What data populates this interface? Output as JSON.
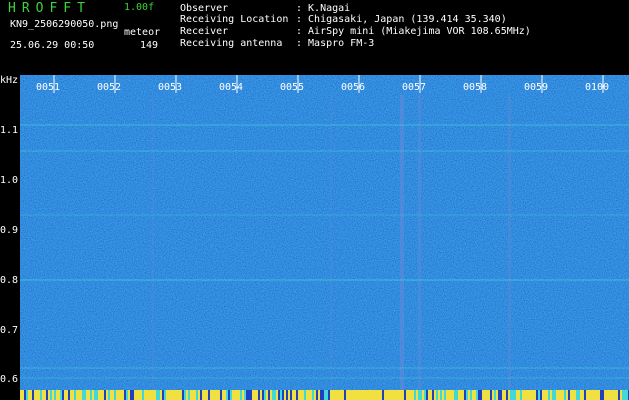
{
  "header": {
    "logo": "HROFFT",
    "version": "1.00f",
    "filename": "KN9_2506290050.png",
    "mode": "meteor",
    "datetime": "25.06.29 00:50",
    "count": "149",
    "rows": [
      {
        "label": "Observer",
        "value": ": K.Nagai"
      },
      {
        "label": "Receiving Location",
        "value": ": Chigasaki, Japan (139.414 35.340)"
      },
      {
        "label": "Receiver",
        "value": ": AirSpy mini (Miakejima VOR 108.65MHz)"
      },
      {
        "label": "Receiving antenna",
        "value": ": Maspro FM-3"
      }
    ]
  },
  "axis": {
    "unit": "kHz",
    "ticks": [
      "1.1",
      "1.0",
      "0.9",
      "0.8",
      "0.7",
      "0.6"
    ],
    "time_labels": [
      "0051",
      "0052",
      "0053",
      "0054",
      "0055",
      "0056",
      "0057",
      "0058",
      "0059",
      "0100"
    ]
  },
  "colors": {
    "bg": "#000000",
    "spectrum": "#1a2fa8",
    "accent_green": "#3bd43b",
    "signal_cyan": "#38d0d0",
    "bottom_yellow": "#f0e040"
  }
}
